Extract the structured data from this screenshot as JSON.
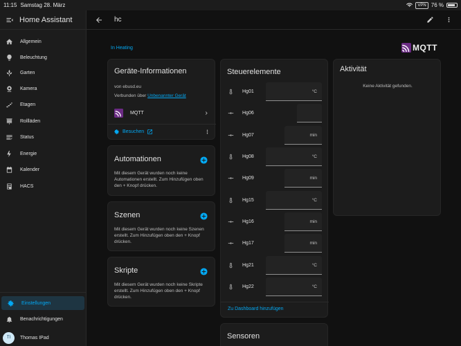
{
  "statusbar": {
    "time": "11:15",
    "date": "Samstag 28. März",
    "vpn": "VPN",
    "battery": "76 %"
  },
  "sidebar": {
    "app_title": "Home Assistant",
    "items": [
      {
        "label": "Allgemein",
        "icon": "home-icon"
      },
      {
        "label": "Beleuchtung",
        "icon": "lightbulb-icon"
      },
      {
        "label": "Garten",
        "icon": "garden-icon"
      },
      {
        "label": "Kamera",
        "icon": "camera-icon"
      },
      {
        "label": "Etagen",
        "icon": "stairs-icon"
      },
      {
        "label": "Rollläden",
        "icon": "blinds-icon"
      },
      {
        "label": "Status",
        "icon": "list-icon"
      },
      {
        "label": "Energie",
        "icon": "lightning-icon"
      },
      {
        "label": "Kalender",
        "icon": "calendar-icon"
      },
      {
        "label": "HACS",
        "icon": "hacs-icon"
      }
    ],
    "settings": "Einstellungen",
    "notifications": "Benachrichtigungen",
    "user": {
      "initials": "TI",
      "name": "Thomas IPad"
    }
  },
  "topbar": {
    "title": "hc"
  },
  "area_link": "In Heating",
  "logo_text": "MQTT",
  "device_info": {
    "title": "Geräte-Informationen",
    "by": "von ebusd.eu",
    "connected_prefix": "Verbunden über",
    "connected_link": "Unbenannter Gerät",
    "integration": "MQTT",
    "visit": "Besuchen"
  },
  "automations": {
    "title": "Automationen",
    "text": "Mit diesem Gerät wurden noch keine Automationen erstellt. Zum Hinzufügen oben den + Knopf drücken."
  },
  "scenes": {
    "title": "Szenen",
    "text": "Mit diesem Gerät wurden noch keine Szenen erstellt. Zum Hinzufügen oben den + Knopf drücken."
  },
  "scripts": {
    "title": "Skripte",
    "text": "Mit diesem Gerät wurden noch keine Skripte erstellt. Zum Hinzufügen oben den + Knopf drücken."
  },
  "controls": {
    "title": "Steuerelemente",
    "rows": [
      {
        "name": "Hg01",
        "unit": "°C",
        "icon": "thermometer-icon"
      },
      {
        "name": "Hg06",
        "unit": "",
        "icon": "slider-icon"
      },
      {
        "name": "Hg07",
        "unit": "min",
        "icon": "slider-icon"
      },
      {
        "name": "Hg08",
        "unit": "°C",
        "icon": "thermometer-icon"
      },
      {
        "name": "Hg09",
        "unit": "min",
        "icon": "slider-icon"
      },
      {
        "name": "Hg15",
        "unit": "°C",
        "icon": "thermometer-icon"
      },
      {
        "name": "Hg16",
        "unit": "min",
        "icon": "slider-icon"
      },
      {
        "name": "Hg17",
        "unit": "min",
        "icon": "slider-icon"
      },
      {
        "name": "Hg21",
        "unit": "°C",
        "icon": "thermometer-icon"
      },
      {
        "name": "Hg22",
        "unit": "°C",
        "icon": "thermometer-icon"
      }
    ],
    "footer": "Zu Dashboard hinzufügen"
  },
  "sensors": {
    "title": "Sensoren"
  },
  "activity": {
    "title": "Aktivität",
    "empty": "Keine Aktivität gefunden."
  },
  "colors": {
    "accent": "#03a9f4",
    "background": "#111111",
    "card": "#1c1c1c"
  }
}
